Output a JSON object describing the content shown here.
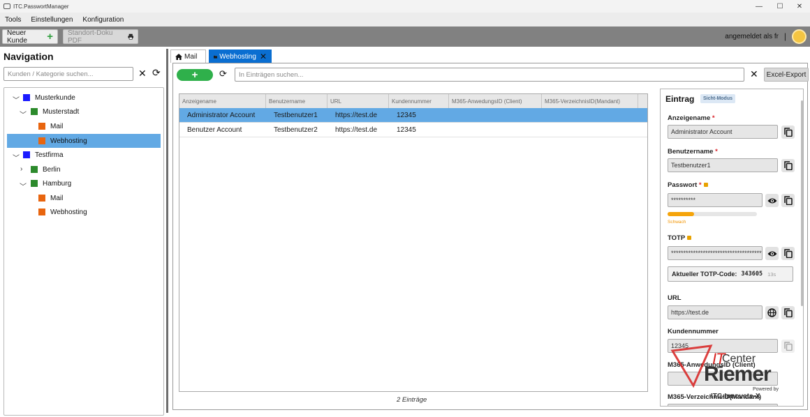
{
  "window": {
    "title": "ITC.PasswortManager",
    "controls": {
      "minimize": "—",
      "maximize": "☐",
      "close": "✕"
    }
  },
  "menu": [
    "Tools",
    "Einstellungen",
    "Konfiguration"
  ],
  "toolbar": {
    "new_customer": "Neuer Kunde",
    "doc_pdf": "Standort-Doku PDF",
    "logged_in": "angemeldet als fr",
    "separator": "|"
  },
  "navigation": {
    "title": "Navigation",
    "search_placeholder": "Kunden / Kategorie suchen...",
    "tree": [
      {
        "label": "Musterkunde",
        "color": "#1a1aff"
      },
      {
        "label": "Musterstadt",
        "color": "#2c8a2c"
      },
      {
        "label": "Mail",
        "color": "#e8650f"
      },
      {
        "label": "Webhosting",
        "color": "#e8650f"
      },
      {
        "label": "Testfirma",
        "color": "#1a1aff"
      },
      {
        "label": "Berlin",
        "color": "#2c8a2c"
      },
      {
        "label": "Hamburg",
        "color": "#2c8a2c"
      },
      {
        "label": "Mail",
        "color": "#e8650f"
      },
      {
        "label": "Webhosting",
        "color": "#e8650f"
      }
    ]
  },
  "tabs": [
    {
      "label": "Mail"
    },
    {
      "label": "Webhosting"
    }
  ],
  "entries": {
    "add": "+",
    "search_placeholder": "In Einträgen suchen...",
    "excel_export": "Excel-Export",
    "columns": [
      "Anzeigename",
      "Benutzername",
      "URL",
      "Kundennummer",
      "M365-AnwedungsID (Client)",
      "M365-VerzeichnisID(Mandant)"
    ],
    "rows": [
      [
        "Administrator Account",
        "Testbenutzer1",
        "https://test.de",
        "12345"
      ],
      [
        "Benutzer Account",
        "Testbenutzer2",
        "https://test.de",
        "12345"
      ]
    ],
    "count": "2 Einträge"
  },
  "detail": {
    "title": "Eintrag",
    "mode": "Sicht-Modus",
    "required_mark": "*",
    "fields": {
      "display_name": {
        "label": "Anzeigename",
        "value": "Administrator Account"
      },
      "username": {
        "label": "Benutzername",
        "value": "Testbenutzer1"
      },
      "password": {
        "label": "Passwort",
        "value": "**********",
        "strength": "Schwach",
        "strength_level": 0.3
      },
      "totp": {
        "label": "TOTP",
        "value": "****************************************",
        "current_label": "Aktueller TOTP-Code:",
        "code": "343605",
        "seconds": "13s"
      },
      "url": {
        "label": "URL",
        "value": "https://test.de"
      },
      "customer_number": {
        "label": "Kundennummer",
        "value": "12345"
      },
      "m365_client": {
        "label": "M365-AnwedungsID (Client)",
        "value": ""
      },
      "m365_tenant": {
        "label": "M365-VerzeichnisID(Mandant)",
        "value": ""
      }
    }
  },
  "watermark": {
    "it": "IT",
    "center": "Center",
    "riemer": "Riemer",
    "powered": "Powered by",
    "brand": "ITC-Innovate-X"
  }
}
